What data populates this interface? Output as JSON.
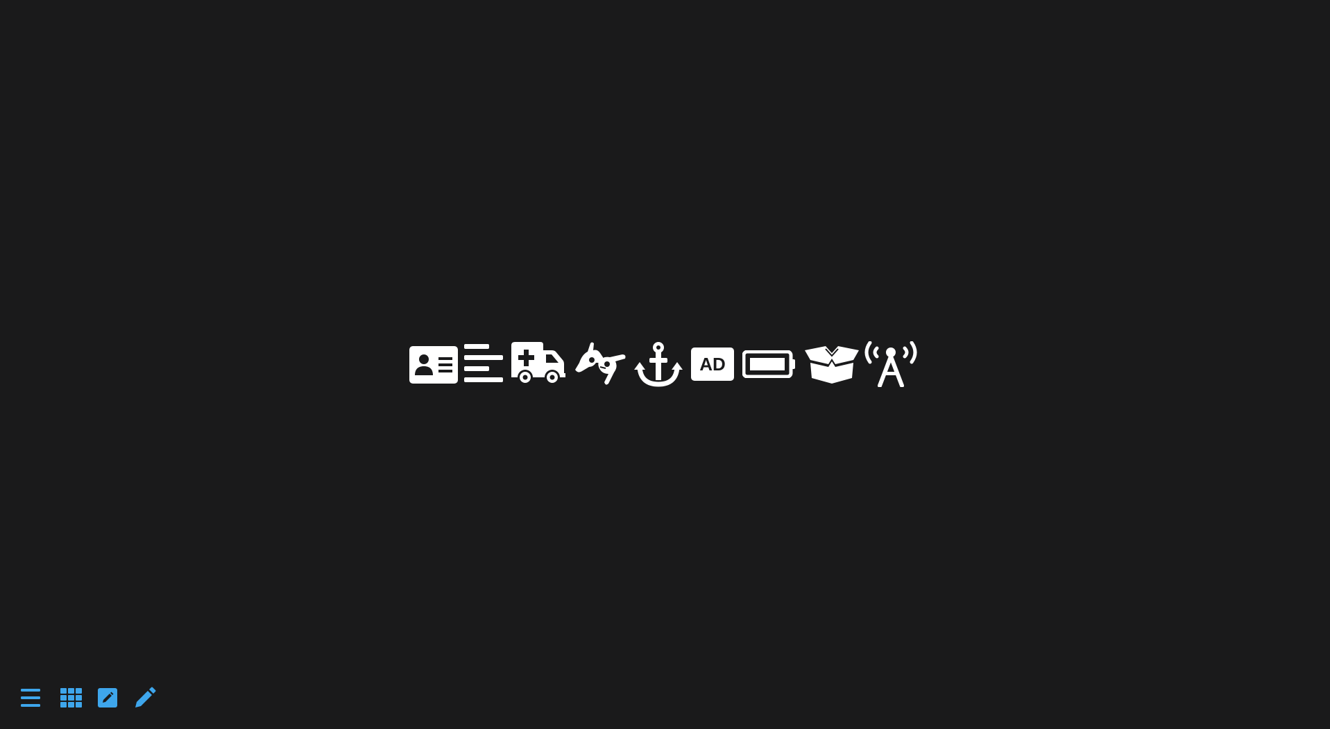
{
  "colors": {
    "background": "#1a1a1b",
    "icon": "#ffffff",
    "toolbar_accent": "#3ea6ec"
  },
  "icons": [
    "address-card-icon",
    "align-left-icon",
    "ambulance-icon",
    "sign-language-icon",
    "anchor-icon",
    "audio-description-icon",
    "battery-full-icon",
    "box-open-icon",
    "broadcast-tower-icon"
  ],
  "ad_badge_text": "AD",
  "toolbar": {
    "items": [
      "list-view-icon",
      "grid-view-icon",
      "edit-square-icon",
      "pencil-icon"
    ]
  }
}
